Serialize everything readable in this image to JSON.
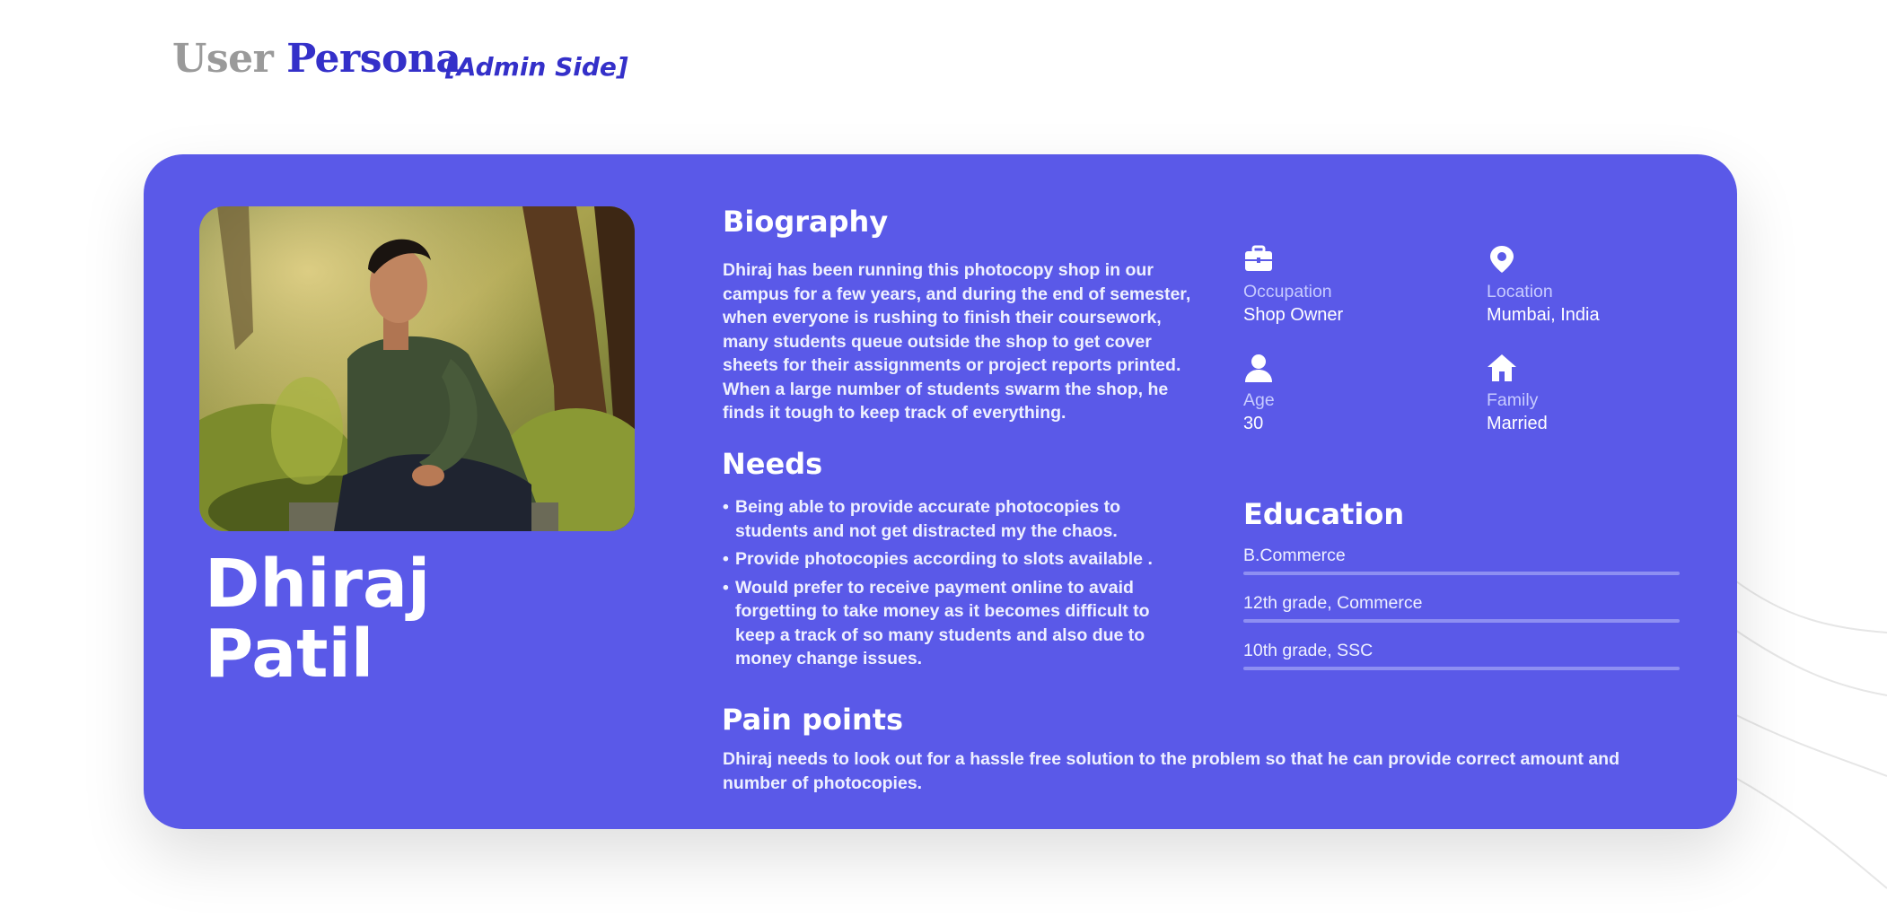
{
  "header": {
    "title_part1": "User",
    "title_part2": "Persona",
    "subtitle": "[Admin Side]"
  },
  "persona": {
    "first_name": "Dhiraj",
    "last_name": "Patil"
  },
  "biography": {
    "heading": "Biography",
    "text": "Dhiraj has been running this photocopy shop in our campus for a few years, and during the end of semester, when everyone is rushing to finish their coursework, many students queue outside the shop to get cover sheets for their assignments or project reports printed. When a large number of students swarm the shop, he finds it tough to keep track of everything."
  },
  "needs": {
    "heading": "Needs",
    "items": [
      "Being able to provide accurate photocopies to students and not get distracted my the chaos.",
      "Provide photocopies according to slots available .",
      "Would prefer to receive payment online to avaid forgetting to take money as it becomes difficult to keep a track of so many students and also due to money change issues."
    ]
  },
  "pain_points": {
    "heading": "Pain points",
    "text": "Dhiraj needs to look out for a hassle free solution to the problem so that he can provide correct amount and number of photocopies."
  },
  "info": {
    "occupation": {
      "label": "Occupation",
      "value": "Shop Owner",
      "icon": "briefcase-icon"
    },
    "location": {
      "label": "Location",
      "value": "Mumbai, India",
      "icon": "location-pin-icon"
    },
    "age": {
      "label": "Age",
      "value": "30",
      "icon": "person-icon"
    },
    "family": {
      "label": "Family",
      "value": "Married",
      "icon": "home-icon"
    }
  },
  "education": {
    "heading": "Education",
    "items": [
      "B.Commerce",
      "12th grade, Commerce",
      "10th grade, SSC"
    ]
  },
  "colors": {
    "card": "#5a59e8",
    "title_accent": "#3430c9",
    "title_grey": "#9a9a9a",
    "muted_label": "#c7cbff",
    "bar": "#8e8ff2"
  }
}
